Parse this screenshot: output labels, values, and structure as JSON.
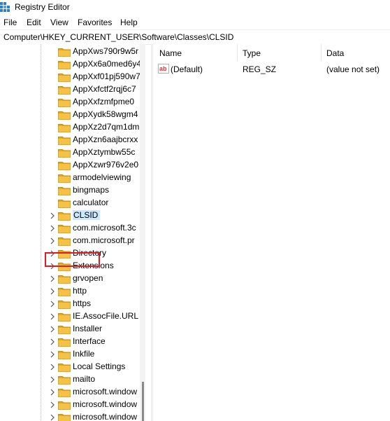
{
  "window": {
    "title": "Registry Editor"
  },
  "menu": [
    "File",
    "Edit",
    "View",
    "Favorites",
    "Help"
  ],
  "address": "Computer\\HKEY_CURRENT_USER\\Software\\Classes\\CLSID",
  "tree": {
    "selected_index": 13,
    "items": [
      {
        "label": "AppXws790r9w5r",
        "expandable": false
      },
      {
        "label": "AppXx6a0med6y4",
        "expandable": false
      },
      {
        "label": "AppXxf01pj590w7",
        "expandable": false
      },
      {
        "label": "AppXxfctf2rqj6c7",
        "expandable": false
      },
      {
        "label": "AppXxfzmfpme0",
        "expandable": false
      },
      {
        "label": "AppXydk58wgm4",
        "expandable": false
      },
      {
        "label": "AppXz2d7qm1dm",
        "expandable": false
      },
      {
        "label": "AppXzn6aajbcrxx",
        "expandable": false
      },
      {
        "label": "AppXztymbw55c",
        "expandable": false
      },
      {
        "label": "AppXzwr976v2e0",
        "expandable": false
      },
      {
        "label": "armodelviewing",
        "expandable": false
      },
      {
        "label": "bingmaps",
        "expandable": false
      },
      {
        "label": "calculator",
        "expandable": false
      },
      {
        "label": "CLSID",
        "expandable": true
      },
      {
        "label": "com.microsoft.3c",
        "expandable": true
      },
      {
        "label": "com.microsoft.pr",
        "expandable": true
      },
      {
        "label": "Directory",
        "expandable": true
      },
      {
        "label": "Extensions",
        "expandable": true
      },
      {
        "label": "grvopen",
        "expandable": true
      },
      {
        "label": "http",
        "expandable": true
      },
      {
        "label": "https",
        "expandable": true
      },
      {
        "label": "IE.AssocFile.URL",
        "expandable": true
      },
      {
        "label": "Installer",
        "expandable": true
      },
      {
        "label": "Interface",
        "expandable": true
      },
      {
        "label": "Inkfile",
        "expandable": true
      },
      {
        "label": "Local Settings",
        "expandable": true
      },
      {
        "label": "mailto",
        "expandable": true
      },
      {
        "label": "microsoft.window",
        "expandable": true
      },
      {
        "label": "microsoft.window",
        "expandable": true
      },
      {
        "label": "microsoft.window",
        "expandable": true
      }
    ]
  },
  "list": {
    "columns": {
      "name": "Name",
      "type": "Type",
      "data": "Data"
    },
    "rows": [
      {
        "name": "(Default)",
        "type": "REG_SZ",
        "data": "(value not set)",
        "icon": "string-value-icon"
      }
    ]
  },
  "colors": {
    "selection": "#cce8ff",
    "highlight_box": "#e01b24",
    "folder": "#f5c243"
  }
}
